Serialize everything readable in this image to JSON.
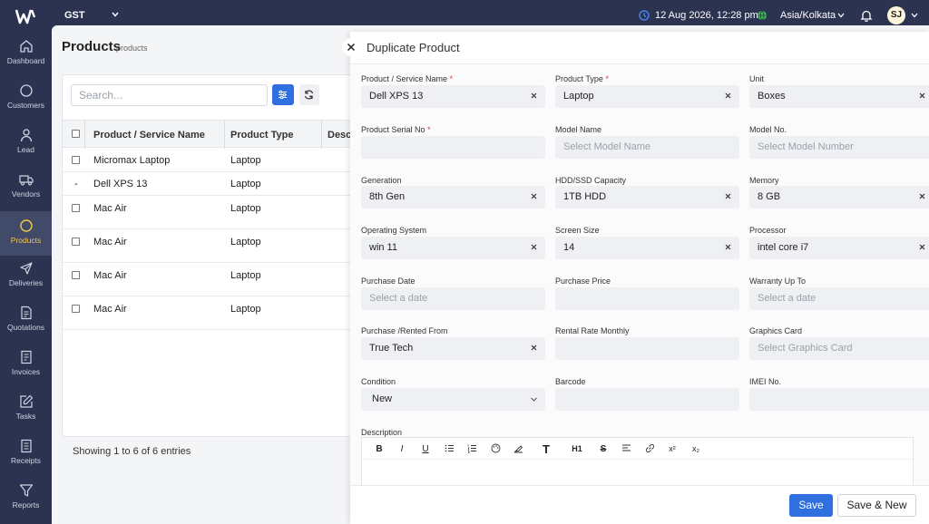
{
  "topbar": {
    "org": "GST",
    "datetime": "12 Aug 2026, 12:28 pm",
    "timezone": "Asia/Kolkata",
    "avatar_initials": "SJ"
  },
  "sidebar": {
    "items": [
      {
        "label": "Dashboard",
        "icon": "home-icon"
      },
      {
        "label": "Customers",
        "icon": "circle-icon"
      },
      {
        "label": "Lead",
        "icon": "user-icon"
      },
      {
        "label": "Vendors",
        "icon": "truck-icon"
      },
      {
        "label": "Products",
        "icon": "circle-icon",
        "active": true
      },
      {
        "label": "Deliveries",
        "icon": "send-icon"
      },
      {
        "label": "Quotations",
        "icon": "document-icon"
      },
      {
        "label": "Invoices",
        "icon": "invoice-icon"
      },
      {
        "label": "Tasks",
        "icon": "edit-icon"
      },
      {
        "label": "Receipts",
        "icon": "receipt-icon"
      },
      {
        "label": "Reports",
        "icon": "filter-icon"
      }
    ]
  },
  "list": {
    "title": "Products",
    "subtitle": "products",
    "search_placeholder": "Search...",
    "columns": [
      "Product / Service Name",
      "Product Type",
      "Descr"
    ],
    "rows": [
      {
        "name": "Micromax Laptop",
        "type": "Laptop"
      },
      {
        "name": "Dell XPS 13",
        "type": "Laptop"
      },
      {
        "name": "Mac Air",
        "type": "Laptop"
      },
      {
        "name": "Mac Air",
        "type": "Laptop"
      },
      {
        "name": "Mac Air",
        "type": "Laptop"
      },
      {
        "name": "Mac Air",
        "type": "Laptop"
      }
    ],
    "entries": "Showing 1 to 6 of 6 entries"
  },
  "drawer": {
    "title": "Duplicate Product",
    "fields": {
      "product_name": {
        "label": "Product / Service Name",
        "value": "Dell XPS 13"
      },
      "product_type": {
        "label": "Product Type",
        "value": "Laptop"
      },
      "unit": {
        "label": "Unit",
        "value": "Boxes"
      },
      "serial_no": {
        "label": "Product Serial No",
        "value": ""
      },
      "model_name": {
        "label": "Model Name",
        "placeholder": "Select Model Name"
      },
      "model_no": {
        "label": "Model No.",
        "placeholder": "Select Model Number"
      },
      "generation": {
        "label": "Generation",
        "value": "8th Gen"
      },
      "hdd": {
        "label": "HDD/SSD Capacity",
        "value": "1TB HDD"
      },
      "memory": {
        "label": "Memory",
        "value": "8 GB"
      },
      "os": {
        "label": "Operating System",
        "value": "win 11"
      },
      "screen": {
        "label": "Screen Size",
        "value": "14"
      },
      "processor": {
        "label": "Processor",
        "value": "intel core i7"
      },
      "purchase_date": {
        "label": "Purchase Date",
        "placeholder": "Select a date"
      },
      "purchase_price": {
        "label": "Purchase Price",
        "value": ""
      },
      "warranty": {
        "label": "Warranty Up To",
        "placeholder": "Select a date"
      },
      "rented_from": {
        "label": "Purchase /Rented From",
        "value": "True Tech"
      },
      "rental_rate": {
        "label": "Rental Rate Monthly",
        "value": ""
      },
      "graphics": {
        "label": "Graphics Card",
        "placeholder": "Select Graphics Card"
      },
      "condition": {
        "label": "Condition",
        "value": "New"
      },
      "barcode": {
        "label": "Barcode",
        "value": ""
      },
      "imei": {
        "label": "IMEI No.",
        "value": ""
      }
    },
    "description_label": "Description",
    "toolbar": [
      "B",
      "I",
      "U",
      "bullet-list-icon",
      "numbered-list-icon",
      "palette-icon",
      "highlight-icon",
      "T",
      "H1",
      "S",
      "align-icon",
      "link-icon",
      "x²",
      "x₂"
    ],
    "save_label": "Save",
    "save_new_label": "Save & New"
  },
  "colors": {
    "nav_bg": "#2c3351",
    "accent": "#2f6fe0",
    "active_nav_text": "#f2c94c"
  }
}
